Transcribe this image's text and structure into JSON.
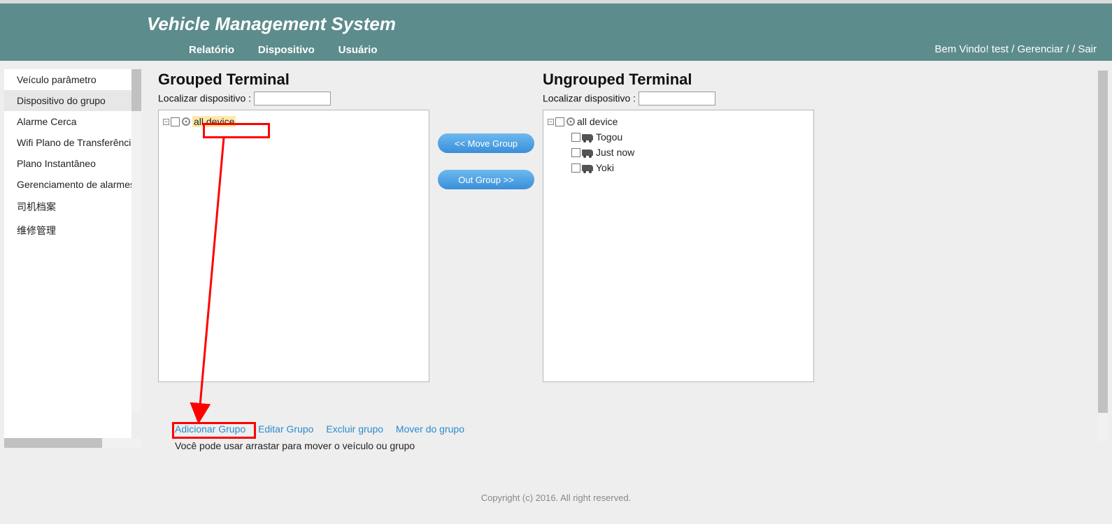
{
  "header": {
    "title": "Vehicle Management System",
    "nav": [
      "Relatório",
      "Dispositivo",
      "Usuário"
    ],
    "welcome": "Bem Vindo!  test ",
    "welcome_link1": "Gerenciar",
    "welcome_sep": " /    /  ",
    "welcome_link2": "Sair"
  },
  "sidebar": [
    "Veículo parâmetro",
    "Dispositivo do grupo",
    "Alarme Cerca",
    "Wifi Plano de Transferência",
    "Plano Instantâneo",
    "Gerenciamento de alarmes",
    "司机档案",
    "维修管理"
  ],
  "sidebar_active_index": 1,
  "grouped": {
    "title": "Grouped Terminal",
    "search_label": "Localizar dispositivo : ",
    "root": "all device"
  },
  "ungrouped": {
    "title": "Ungrouped Terminal",
    "search_label": "Localizar dispositivo : ",
    "root": "all device",
    "items": [
      "Togou",
      "Just now",
      "Yoki"
    ]
  },
  "buttons": {
    "move_in": "<< Move Group",
    "move_out": "Out Group >>"
  },
  "actions": [
    "Adicionar Grupo",
    "Editar Grupo",
    "Excluir grupo",
    "Mover do grupo"
  ],
  "hint": "Você pode usar arrastar para mover o veículo ou grupo",
  "footer": "Copyright (c) 2016. All right reserved."
}
